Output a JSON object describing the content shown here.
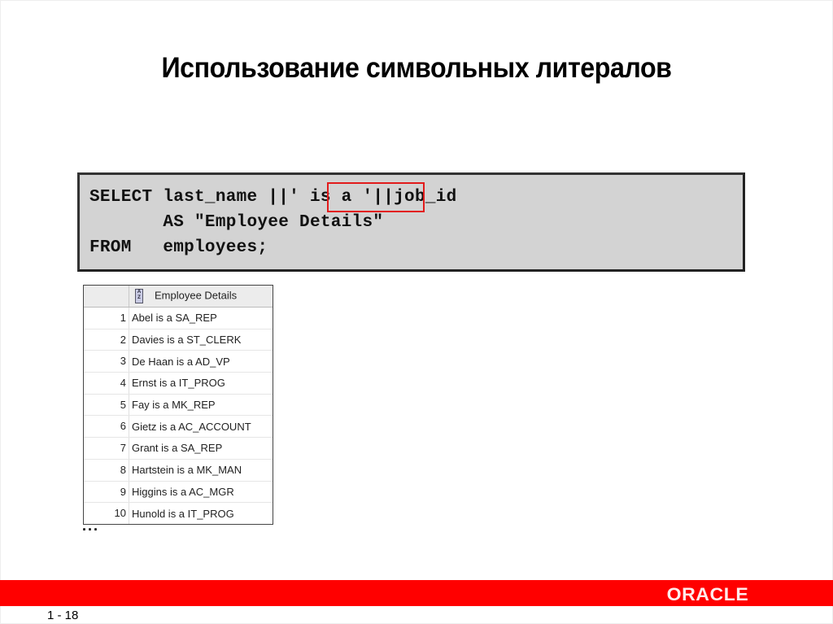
{
  "slide": {
    "title": "Использование символьных литералов",
    "page_number": "1 - 18",
    "brand_logo": "ORACLE",
    "brand_color": "#ff0000",
    "highlight_color": "#e21b1b"
  },
  "code": {
    "lines": [
      "SELECT last_name ||' is a '||job_id",
      "       AS \"Employee Details\"",
      "FROM   employees;"
    ],
    "highlighted_fragment": "' is a '"
  },
  "result_grid": {
    "sort_icon": "az-sort-icon",
    "column_header": "Employee Details",
    "rows": [
      {
        "num": "1",
        "value": "Abel is a SA_REP"
      },
      {
        "num": "2",
        "value": "Davies is a ST_CLERK"
      },
      {
        "num": "3",
        "value": "De Haan is a AD_VP"
      },
      {
        "num": "4",
        "value": "Ernst is a IT_PROG"
      },
      {
        "num": "5",
        "value": "Fay is a MK_REP"
      },
      {
        "num": "6",
        "value": "Gietz is a AC_ACCOUNT"
      },
      {
        "num": "7",
        "value": "Grant is a SA_REP"
      },
      {
        "num": "8",
        "value": "Hartstein is a MK_MAN"
      },
      {
        "num": "9",
        "value": "Higgins is a AC_MGR"
      },
      {
        "num": "10",
        "value": "Hunold is a IT_PROG"
      }
    ],
    "ellipsis": "..."
  }
}
